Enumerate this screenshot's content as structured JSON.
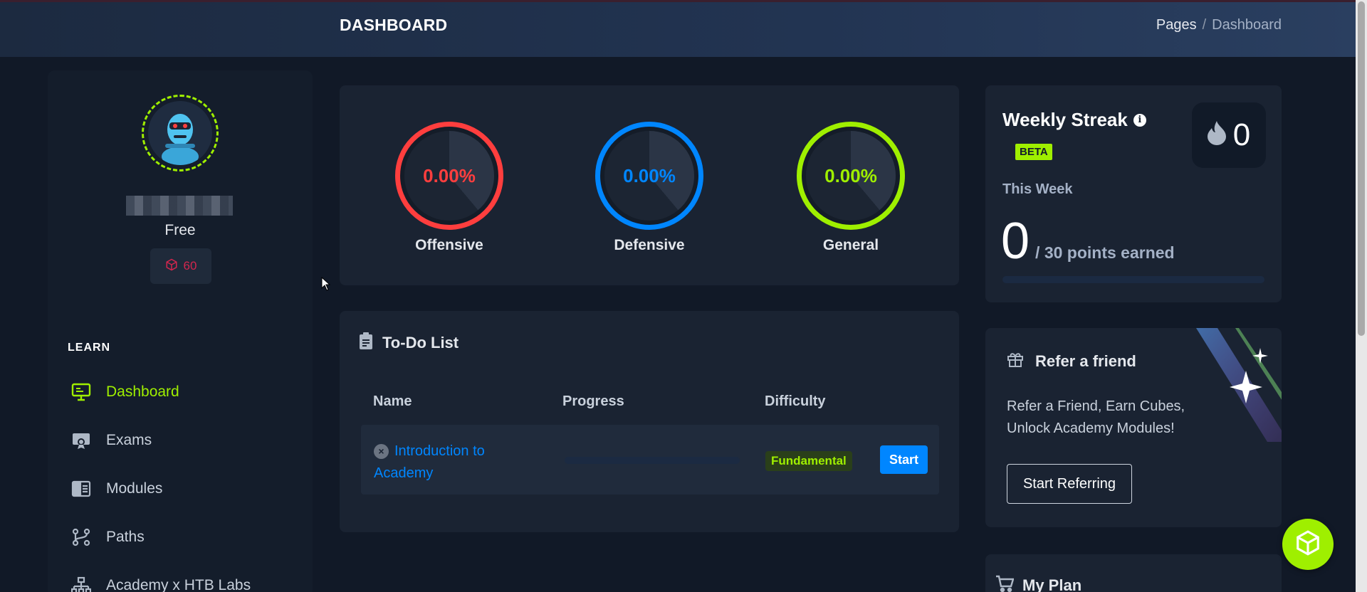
{
  "header": {
    "title": "DASHBOARD",
    "breadcrumb": {
      "root": "Pages",
      "separator": "/",
      "current": "Dashboard"
    }
  },
  "sidebar": {
    "plan": "Free",
    "cubes": "60",
    "section_label": "LEARN",
    "items": [
      {
        "label": "Dashboard",
        "icon": "monitor-icon",
        "active": true
      },
      {
        "label": "Exams",
        "icon": "certificate-icon",
        "active": false
      },
      {
        "label": "Modules",
        "icon": "book-icon",
        "active": false
      },
      {
        "label": "Paths",
        "icon": "path-icon",
        "active": false
      },
      {
        "label": "Academy x HTB Labs",
        "icon": "network-icon",
        "active": false
      }
    ],
    "active_color": "#9fef00"
  },
  "stats": [
    {
      "value": "0.00%",
      "label": "Offensive",
      "color": "#ff3e3e"
    },
    {
      "value": "0.00%",
      "label": "Defensive",
      "color": "#0086ff"
    },
    {
      "value": "0.00%",
      "label": "General",
      "color": "#9fef00"
    }
  ],
  "todo": {
    "title": "To-Do List",
    "columns": [
      "Name",
      "Progress",
      "Difficulty"
    ],
    "rows": [
      {
        "name": "Introduction to Academy",
        "progress": 0,
        "difficulty": "Fundamental",
        "action": "Start"
      }
    ]
  },
  "streak": {
    "title": "Weekly Streak",
    "badge": "BETA",
    "count": "0",
    "this_week_label": "This Week",
    "points": "0",
    "points_suffix": "/ 30 points earned",
    "progress": 0
  },
  "refer": {
    "title": "Refer a friend",
    "text": "Refer a Friend, Earn Cubes, Unlock Academy Modules!",
    "button": "Start Referring"
  },
  "plan_card": {
    "title": "My Plan"
  },
  "colors": {
    "accent": "#9fef00",
    "blue": "#0086ff",
    "red": "#ff3e3e",
    "bg": "#111927",
    "card": "#1a2332"
  }
}
